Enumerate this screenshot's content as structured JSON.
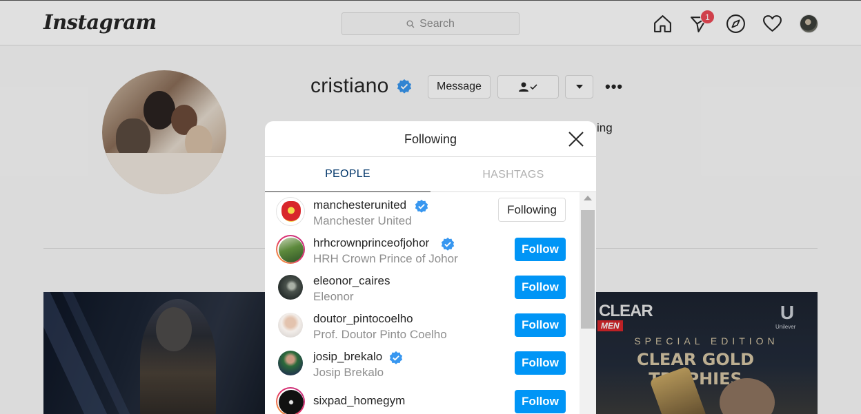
{
  "app": {
    "logo_text": "Instagram"
  },
  "nav": {
    "search_placeholder": "Search",
    "notification_count": "1"
  },
  "profile": {
    "username": "cristiano",
    "message_label": "Message",
    "partial_text": "ing"
  },
  "modal": {
    "title": "Following",
    "tabs": [
      {
        "label": "PEOPLE",
        "active": true
      },
      {
        "label": "HASHTAGS",
        "active": false
      }
    ],
    "rows": [
      {
        "username": "manchesterunited",
        "full_name": "Manchester United",
        "verified": true,
        "button": "Following"
      },
      {
        "username": "hrhcrownprinceofjohor",
        "full_name": "HRH Crown Prince of Johor",
        "verified": true,
        "button": "Follow"
      },
      {
        "username": "eleonor_caires",
        "full_name": "Eleonor",
        "verified": false,
        "button": "Follow"
      },
      {
        "username": "doutor_pintocoelho",
        "full_name": "Prof. Doutor Pinto Coelho",
        "verified": false,
        "button": "Follow"
      },
      {
        "username": "josip_brekalo",
        "full_name": "Josip Brekalo",
        "verified": true,
        "button": "Follow"
      },
      {
        "username": "sixpad_homegym",
        "full_name": "",
        "verified": false,
        "button": "Follow"
      }
    ]
  },
  "posts": {
    "right_ad": {
      "brand": "CLEAR",
      "brand_sub": "MEN",
      "maker": "Unilever",
      "tagline": "SPECIAL EDITION",
      "headline": "CLEAR GOLD TROPHIES"
    }
  },
  "colors": {
    "accent_blue": "#0095f6",
    "verified_blue": "#3897f0",
    "badge_red": "#ed4956",
    "tab_active": "#003569"
  }
}
